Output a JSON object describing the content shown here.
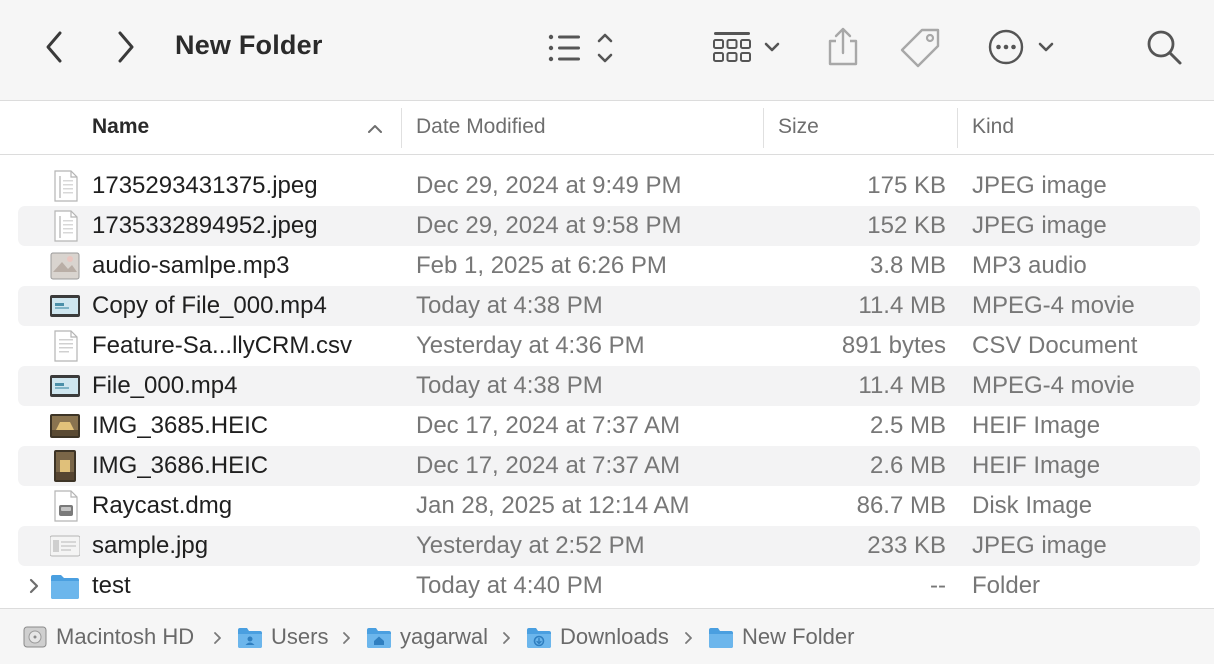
{
  "window": {
    "title": "New Folder"
  },
  "toolbar": {
    "back_icon": "chevron-left-icon",
    "forward_icon": "chevron-right-icon",
    "view_icon": "list-view-icon",
    "group_icon": "group-grid-icon",
    "share_icon": "share-icon",
    "tag_icon": "tag-icon",
    "more_icon": "ellipsis-circle-icon",
    "search_icon": "magnifier-icon"
  },
  "columns": {
    "name": "Name",
    "date": "Date Modified",
    "size": "Size",
    "kind": "Kind",
    "sort": "ascending"
  },
  "files": [
    {
      "name": "1735293431375.jpeg",
      "date": "Dec 29, 2024 at 9:49 PM",
      "size": "175 KB",
      "kind": "JPEG image",
      "icon": "document-icon"
    },
    {
      "name": "1735332894952.jpeg",
      "date": "Dec 29, 2024 at 9:58 PM",
      "size": "152 KB",
      "kind": "JPEG image",
      "icon": "document-icon"
    },
    {
      "name": "audio-samlpe.mp3",
      "date": "Feb 1, 2025 at 6:26 PM",
      "size": "3.8 MB",
      "kind": "MP3 audio",
      "icon": "audio-thumbnail-icon"
    },
    {
      "name": "Copy of File_000.mp4",
      "date": "Today at 4:38 PM",
      "size": "11.4 MB",
      "kind": "MPEG-4 movie",
      "icon": "video-thumbnail-icon"
    },
    {
      "name": "Feature-Sa...llyCRM.csv",
      "date": "Yesterday at 4:36 PM",
      "size": "891 bytes",
      "kind": "CSV Document",
      "icon": "csv-document-icon"
    },
    {
      "name": "File_000.mp4",
      "date": "Today at 4:38 PM",
      "size": "11.4 MB",
      "kind": "MPEG-4 movie",
      "icon": "video-thumbnail-icon"
    },
    {
      "name": "IMG_3685.HEIC",
      "date": "Dec 17, 2024 at 7:37 AM",
      "size": "2.5 MB",
      "kind": "HEIF Image",
      "icon": "photo-thumbnail-icon"
    },
    {
      "name": "IMG_3686.HEIC",
      "date": "Dec 17, 2024 at 7:37 AM",
      "size": "2.6 MB",
      "kind": "HEIF Image",
      "icon": "photo-thumbnail-icon"
    },
    {
      "name": "Raycast.dmg",
      "date": "Jan 28, 2025 at 12:14 AM",
      "size": "86.7 MB",
      "kind": "Disk Image",
      "icon": "disk-image-icon"
    },
    {
      "name": "sample.jpg",
      "date": "Yesterday at 2:52 PM",
      "size": "233 KB",
      "kind": "JPEG image",
      "icon": "image-thumbnail-icon"
    },
    {
      "name": "test",
      "date": "Today at 4:40 PM",
      "size": "--",
      "kind": "Folder",
      "icon": "folder-icon"
    }
  ],
  "pathbar": [
    {
      "label": "Macintosh HD",
      "icon": "hard-drive-icon"
    },
    {
      "label": "Users",
      "icon": "users-folder-icon"
    },
    {
      "label": "yagarwal",
      "icon": "home-folder-icon"
    },
    {
      "label": "Downloads",
      "icon": "downloads-folder-icon"
    },
    {
      "label": "New Folder",
      "icon": "folder-icon"
    }
  ],
  "colors": {
    "accent_folder": "#5aa9e6",
    "row_alt": "#f3f3f4",
    "toolbar_bg": "#f6f6f6",
    "secondary_text": "#777777"
  }
}
